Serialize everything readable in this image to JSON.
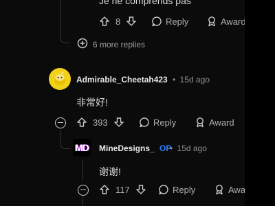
{
  "comment_top": {
    "text": "Je ne comprends pas",
    "votes": "8",
    "reply_label": "Reply",
    "award_label": "Award"
  },
  "more_replies": {
    "label": "6 more replies"
  },
  "comment_main": {
    "username": "Admirable_Cheetah423",
    "separator": "•",
    "age": "15d ago",
    "text": "非常好!",
    "votes": "393",
    "reply_label": "Reply",
    "award_label": "Award"
  },
  "comment_reply": {
    "username": "MineDesigns_",
    "op_badge": "OP",
    "separator": "•",
    "age": "15d ago",
    "avatar_text": "MD",
    "text": "谢谢!",
    "votes": "117",
    "reply_label": "Reply",
    "award_label": "Award"
  },
  "colors": {
    "background": "#0b0b0b",
    "text": "#d7dadc",
    "muted": "#8e9193",
    "op_accent": "#2f80ff",
    "avatar_yellow": "#f2d11b",
    "md_avatar_bg": "#000000",
    "md_accent": "#c02bd6"
  }
}
